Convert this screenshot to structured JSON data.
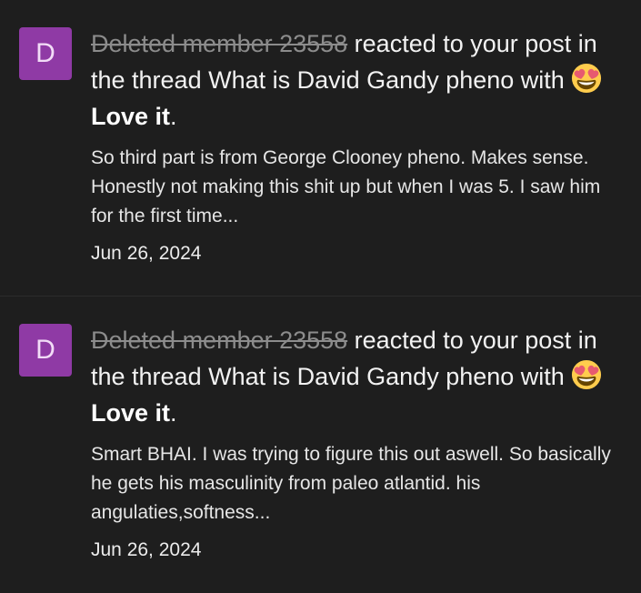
{
  "alerts": [
    {
      "avatar_letter": "D",
      "username": "Deleted member 23558",
      "action_text": " reacted to your post in the thread What is David Gandy pheno with ",
      "reaction_label": "Love it",
      "period": ".",
      "reaction_icon": "heart-eyes-emoji-icon",
      "snippet": "So third part is from George Clooney pheno. Makes sense. Honestly not making this shit up but when I was 5. I saw him for the first time...",
      "date": "Jun 26, 2024"
    },
    {
      "avatar_letter": "D",
      "username": "Deleted member 23558",
      "action_text": " reacted to your post in the thread What is David Gandy pheno with ",
      "reaction_label": "Love it",
      "period": ".",
      "reaction_icon": "heart-eyes-emoji-icon",
      "snippet": "Smart BHAI. I was trying to figure this out aswell. So basically he gets his masculinity from paleo atlantid. his angulaties,softness...",
      "date": "Jun 26, 2024"
    }
  ],
  "colors": {
    "background": "#1e1e1e",
    "avatar_bg": "#8f3aa5",
    "username": "#8c8c8c",
    "text": "#f2f2f2"
  }
}
